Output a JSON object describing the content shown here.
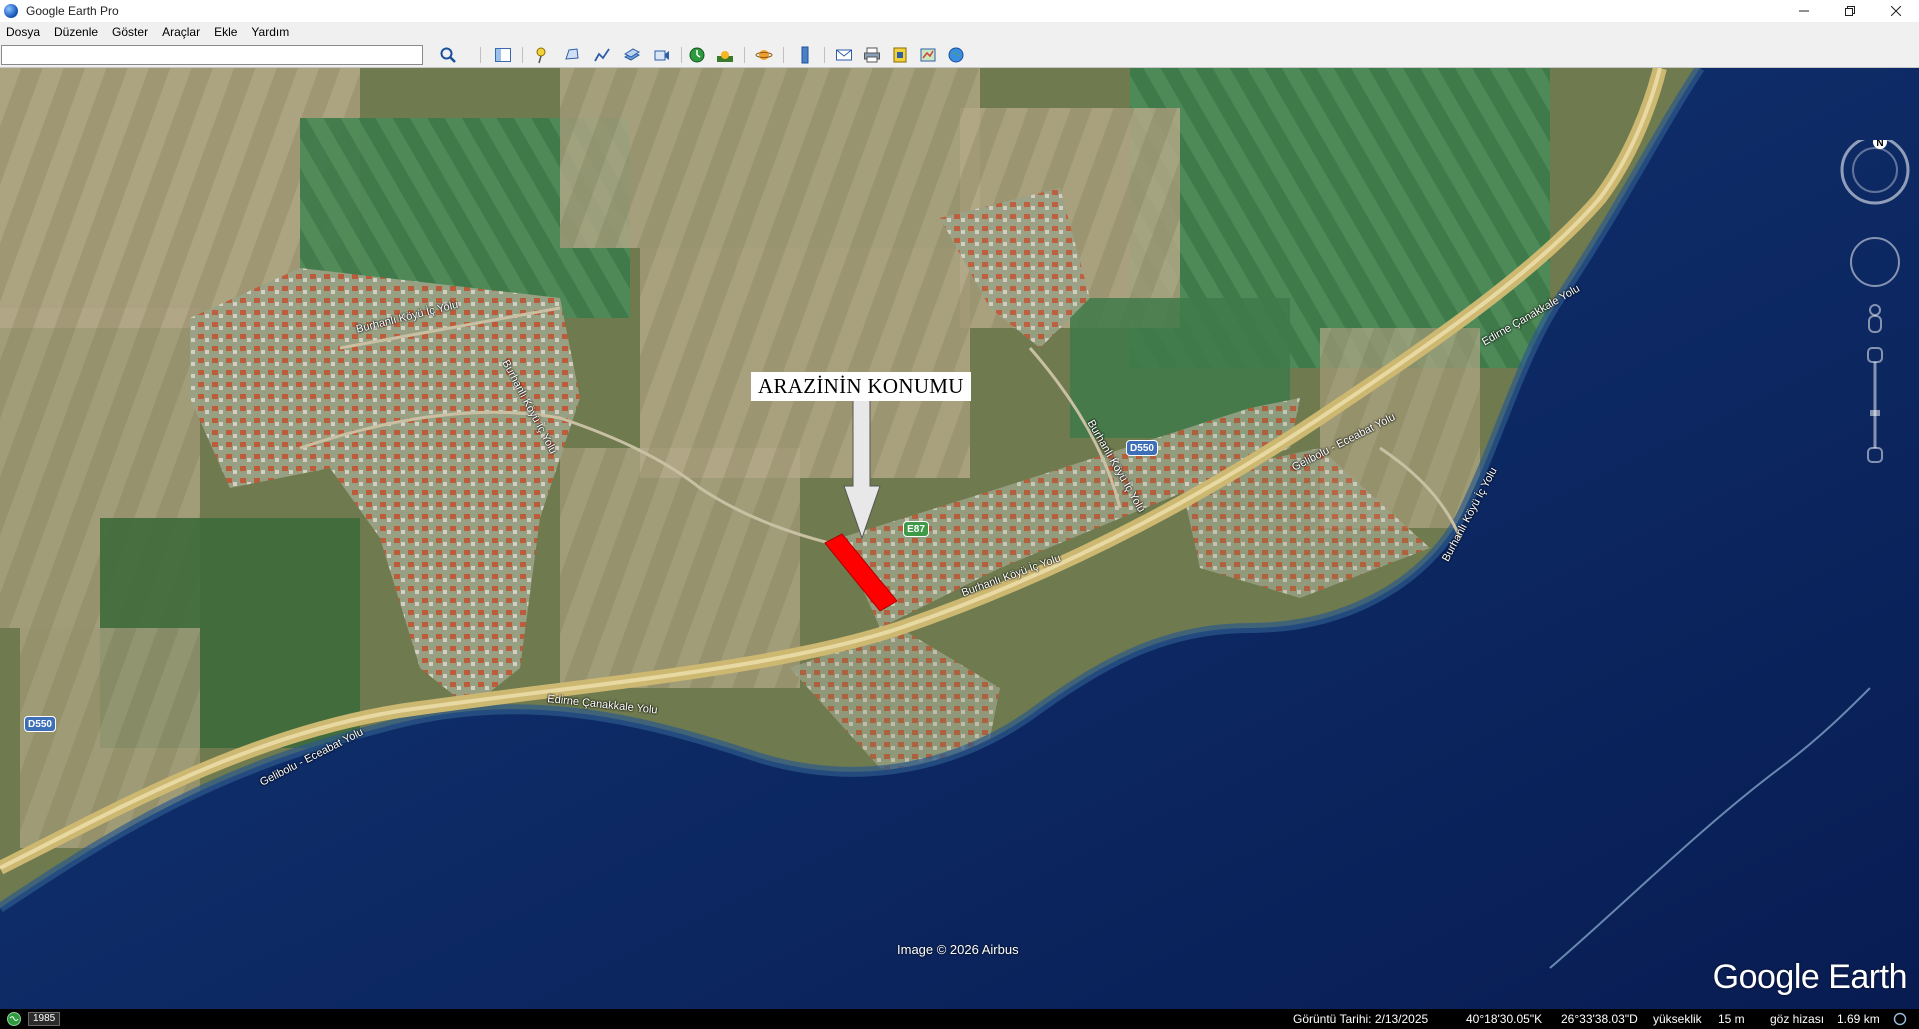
{
  "window": {
    "title": "Google Earth Pro"
  },
  "menu": [
    {
      "label": "Dosya"
    },
    {
      "label": "Düzenle"
    },
    {
      "label": "Göster"
    },
    {
      "label": "Araçlar"
    },
    {
      "label": "Ekle"
    },
    {
      "label": "Yardım"
    }
  ],
  "search": {
    "value": ""
  },
  "map": {
    "annotation": "ARAZİNİN KONUMU",
    "copyright": "Image © 2026 Airbus",
    "logo": "Google Earth",
    "compass_letter": "N",
    "road_labels": {
      "main_west": "Gelibolu - Eceabat Yolu",
      "main_center": "Edirne Çanakkale Yolu",
      "main_east": "Gelibolu - Eceabat Yolu",
      "village_1": "Burhanlı Köyü İç Yolu",
      "village_2": "Burhanlı Köyü İç Yolu",
      "village_3": "Burhanlı Köyü İç Yolu",
      "village_4": "Burhanlı Köyü İç Yolu",
      "village_5": "Burhanlı Köyü İç Yolu",
      "coast": "Burhanlı Köyü İç Yolu",
      "northeast": "Edirne Çanakkale Yolu"
    },
    "shields": {
      "d550_west": "D550",
      "d550_center": "D550",
      "e87": "E87"
    }
  },
  "status": {
    "year": "1985",
    "imagery_date": "Görüntü Tarihi: 2/13/2025",
    "lat": "40°18'30.05\"K",
    "lon": "26°33'38.03\"D",
    "elevation_label": "yükseklik",
    "elevation_value": "15 m",
    "eye_label": "göz hizası",
    "eye_value": "1.69 km"
  },
  "colors": {
    "sea": "#0d2a6b",
    "land": "#6f7b4e",
    "road": "#d8c27a",
    "parcel": "#ff0000"
  }
}
